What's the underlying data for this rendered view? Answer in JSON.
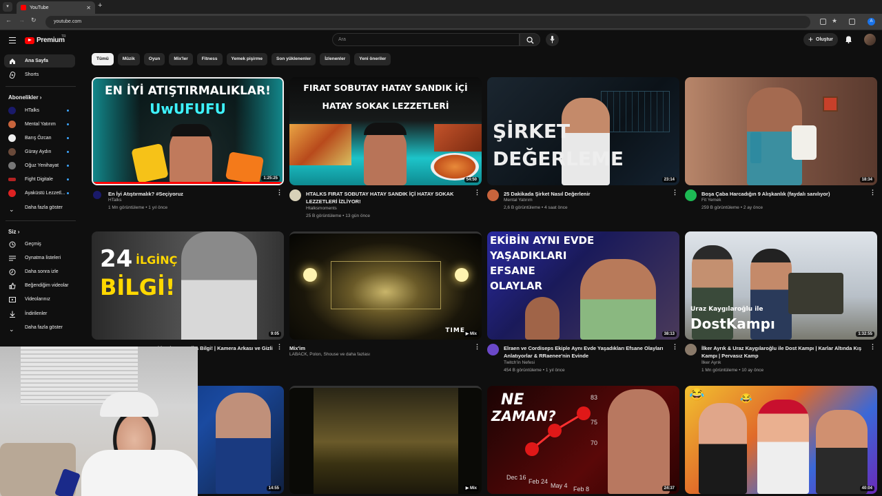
{
  "browser": {
    "tab_title": "YouTube",
    "url": "youtube.com",
    "profile_initial": "A"
  },
  "header": {
    "logo_text": "Premium",
    "region": "TR",
    "search_placeholder": "Ara",
    "create_label": "Oluştur"
  },
  "sidebar": {
    "main": [
      {
        "label": "Ana Sayfa",
        "icon": "home-icon"
      },
      {
        "label": "Shorts",
        "icon": "shorts-icon"
      }
    ],
    "subs_heading": "Abonelikler",
    "subs": [
      {
        "label": "HTalks",
        "color": "#1a1a6a"
      },
      {
        "label": "Mental Yatırım",
        "color": "#c8643c"
      },
      {
        "label": "Barış Özcan",
        "color": "#eeeeee"
      },
      {
        "label": "Güray Aydın",
        "color": "#6a4a3a"
      },
      {
        "label": "Oğuz Yenihayat",
        "color": "#777777"
      },
      {
        "label": "Fight Digitale",
        "color": "#b22222"
      },
      {
        "label": "Ayaküstü Lezzetl...",
        "color": "#dd2222"
      }
    ],
    "show_more": "Daha fazla göster",
    "you_heading": "Siz",
    "you": [
      {
        "label": "Geçmiş",
        "icon": "history-icon"
      },
      {
        "label": "Oynatma listeleri",
        "icon": "playlists-icon"
      },
      {
        "label": "Daha sonra izle",
        "icon": "watch-later-icon"
      },
      {
        "label": "Beğendiğim videolar",
        "icon": "liked-icon"
      },
      {
        "label": "Videolarınız",
        "icon": "your-videos-icon"
      },
      {
        "label": "İndirilenler",
        "icon": "downloads-icon"
      }
    ],
    "show_more2": "Daha fazla göster"
  },
  "chips": [
    "Tümü",
    "Müzik",
    "Oyun",
    "Mix'ler",
    "Fitness",
    "Yemek pişirme",
    "Son yüklenenler",
    "İzlenenler",
    "Yeni öneriler"
  ],
  "thumb_text": {
    "v1a": "EN İYİ ATIŞTIRMALIKLAR!",
    "v1b": "UwUFUFU",
    "v2a": "FIRAT SOBUTAY HATAY SANDIK İÇİ",
    "v2b": "HATAY SOKAK LEZZETLERİ",
    "v3a": "ŞİRKET",
    "v3b": "DEĞERLEME",
    "v5a": "24",
    "v5b": "İLGİNÇ",
    "v5c": "BİLGİ!",
    "v6": "TIME",
    "v7a": "EKİBİN AYNI EVDE",
    "v7b": "YAŞADIKLARI",
    "v7c": "EFSANE",
    "v7d": "OLAYLAR",
    "v8a": "Uraz Kaygılaroğlu ile",
    "v8b": "DostKampı",
    "v11a": "NE",
    "v11b": "ZAMAN?",
    "v11x": [
      "Dec 16",
      "Feb 24",
      "May 4",
      "Feb 8"
    ],
    "v11y": [
      "83",
      "75",
      "70"
    ]
  },
  "videos": [
    {
      "title": "En İyi Atıştırmalık? #Seçiyoruz",
      "channel": "HTalks",
      "stats": "1 Mn görüntüleme • 1 yıl önce",
      "duration": "1:25:25"
    },
    {
      "title": "HTALKS FIRAT SOBUTAY HATAY SANDIK İÇİ  HATAY SOKAK LEZZETLERİ İZLİYOR!",
      "channel": "Htalksmoments",
      "stats": "25 B görüntüleme • 13 gün önce",
      "duration": "54:50"
    },
    {
      "title": "25 Dakikada Şirket Nasıl Değerlenir",
      "channel": "Mental Yatırım",
      "stats": "2,6 B görüntüleme • 4 saat önce",
      "duration": "23:14"
    },
    {
      "title": "Boşa Çaba Harcadığın 9 Alışkanlık (faydalı sanılıyor)",
      "channel": "Fit Yemek",
      "stats": "259 B görüntüleme • 2 ay önce",
      "duration": "18:34"
    },
    {
      "title": "12 KIZGIN ADAM Hakkında 24 Harika Bilgi! | Kamera Arkası ve Gizli",
      "channel": "",
      "stats": "",
      "duration": "9:05"
    },
    {
      "title": "Mix'im",
      "channel": "LABACK, Polon, Shouse ve daha fazlası",
      "stats": "",
      "duration": "Mix"
    },
    {
      "title": "Elraen ve Cordiseps Ekiple Aynı Evde Yaşadıkları Efsane Olayları Anlatıyorlar & RRaenee'nin Evinde",
      "channel": "Twitch'in Nefesi",
      "stats": "454 B görüntüleme • 1 yıl önce",
      "duration": "38:13"
    },
    {
      "title": "İlker Ayrık & Uraz Kaygılaroğlu ile Dost Kampı | Karlar Altında Kış Kampı | Pervasız Kamp",
      "channel": "İlker Ayrık",
      "stats": "1 Mn görüntüleme • 10 ay önce",
      "duration": "1:32:55"
    },
    {
      "duration": "14:55"
    },
    {
      "duration": "Mix"
    },
    {
      "duration": "24:37"
    },
    {
      "duration": "40:04"
    }
  ],
  "colors": {
    "accent": "#ff0000",
    "bg": "#0f0f0f",
    "link_blue": "#3ea6ff"
  }
}
